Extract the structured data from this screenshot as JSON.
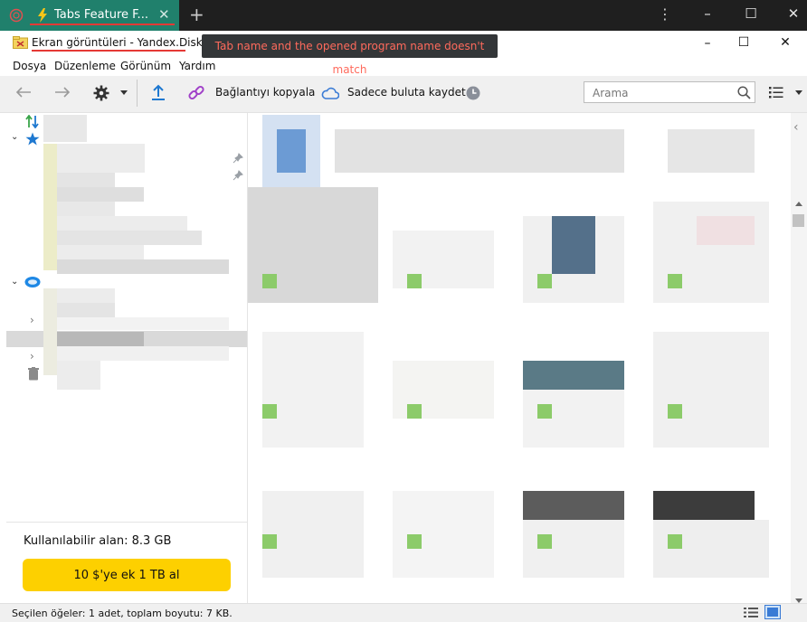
{
  "tab": {
    "title": "Tabs Feature F...",
    "close": "✕",
    "new_tab": "+"
  },
  "window_controls": {
    "minimize": "–",
    "maximize": "☐",
    "close": "✕"
  },
  "browser_menu": "⋮",
  "app": {
    "title": "Ekran görüntüleri - Yandex.Disk"
  },
  "annotation": {
    "text": "Tab name and the opened program name doesn't match"
  },
  "menu": [
    "Dosya",
    "Düzenleme",
    "Görünüm",
    "Yardım"
  ],
  "toolbar": {
    "copy_link": "Bağlantıyı kopyala",
    "save_cloud": "Sadece buluta kaydet",
    "search_placeholder": "Arama"
  },
  "sidebar": {
    "available": "Kullanılabilir alan: 8.3 GB",
    "promo": "10 $'ye ek 1 TB al"
  },
  "status": {
    "text": "Seçilen öğeler: 1 adet, toplam boyutu: 7 KB."
  },
  "colors": {
    "tab_bg": "#20806c",
    "tabbar_bg": "#1f1f1f",
    "accent_red": "#e53935",
    "promo_yellow": "#fdd000",
    "link_purple": "#a040c8",
    "cloud_blue": "#3a7bd5",
    "thumb_green": "#8ccb6a"
  },
  "icons": {
    "tab_icon": "circle-ring-icon",
    "tab_favicon": "lightning-icon",
    "app_icon": "folder-scissors-icon",
    "back": "arrow-left-icon",
    "forward": "arrow-right-icon",
    "settings": "gear-icon",
    "upload": "upload-icon",
    "link": "link-icon",
    "cloud": "cloud-icon",
    "history": "clock-icon",
    "search": "search-icon",
    "view": "list-view-icon",
    "trash": "trash-icon",
    "sync": "sync-arrows-icon",
    "favorites": "star-icon",
    "disk": "yandex-disk-icon",
    "pin": "pin-icon"
  }
}
